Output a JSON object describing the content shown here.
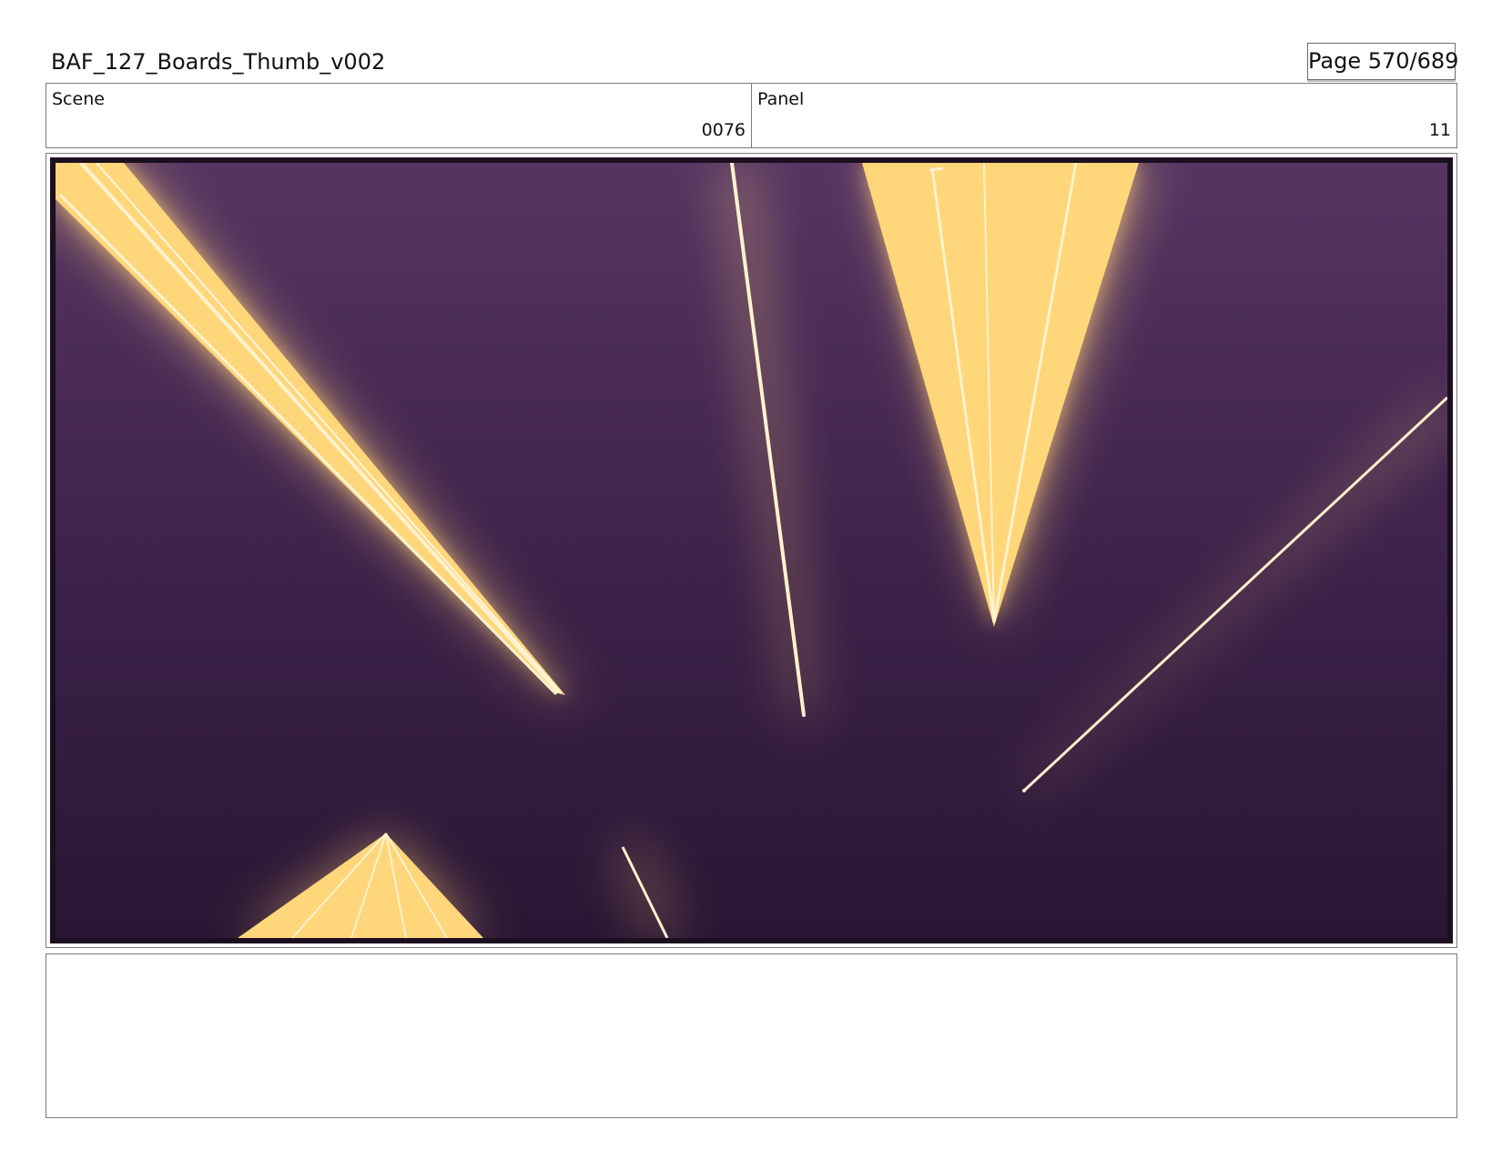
{
  "document": {
    "title": "BAF_127_Boards_Thumb_v002",
    "page_label": "Page 570/689"
  },
  "info": {
    "scene_label": "Scene",
    "scene_value": "0076",
    "panel_label": "Panel",
    "panel_value": "11"
  },
  "frame": {
    "image_name": "storyboard-panel-light-beams",
    "colors": {
      "background_top": "#563563",
      "background_bottom": "#2a1634",
      "beam": "#ffd67a",
      "beam_line": "#fff2cf",
      "glow": "#ffcf7a",
      "border": "#1c1020"
    }
  },
  "notes": {
    "text": ""
  }
}
